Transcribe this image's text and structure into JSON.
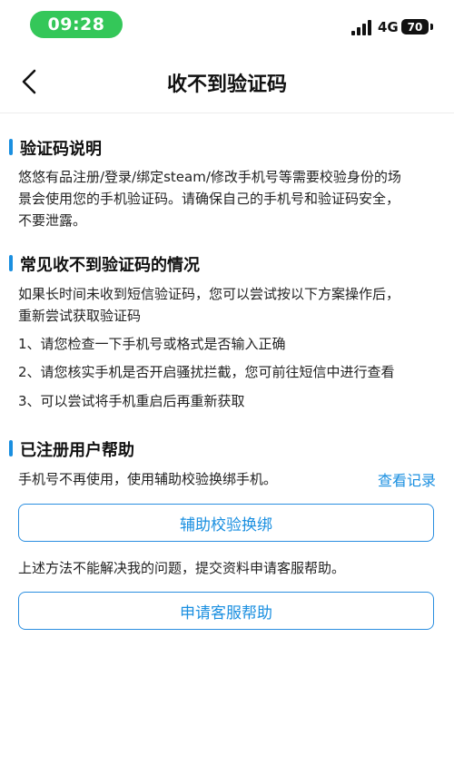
{
  "status_bar": {
    "time": "09:28",
    "network": "4G",
    "battery": "70"
  },
  "nav": {
    "title": "收不到验证码"
  },
  "section1": {
    "title": "验证码说明",
    "lines": [
      "悠悠有品注册/登录/绑定steam/修改手机号等需要校验身份的场",
      "景会使用您的手机验证码。请确保自己的手机号和验证码安全，",
      "不要泄露。"
    ]
  },
  "section2": {
    "title": "常见收不到验证码的情况",
    "intro_lines": [
      "如果长时间未收到短信验证码，您可以尝试按以下方案操作后，",
      "重新尝试获取验证码"
    ],
    "items": [
      "1、请您检查一下手机号或格式是否输入正确",
      "2、请您核实手机是否开启骚扰拦截，您可前往短信中进行查看",
      "3、可以尝试将手机重启后再重新获取"
    ]
  },
  "section3": {
    "title": "已注册用户帮助",
    "desc": "手机号不再使用，使用辅助校验换绑手机。",
    "link": "查看记录",
    "assist_button": "辅助校验换绑",
    "help_desc": "上述方法不能解决我的问题，提交资料申请客服帮助。",
    "service_button": "申请客服帮助"
  },
  "colors": {
    "accent": "#1a8fe0",
    "time_pill": "#34c759"
  }
}
